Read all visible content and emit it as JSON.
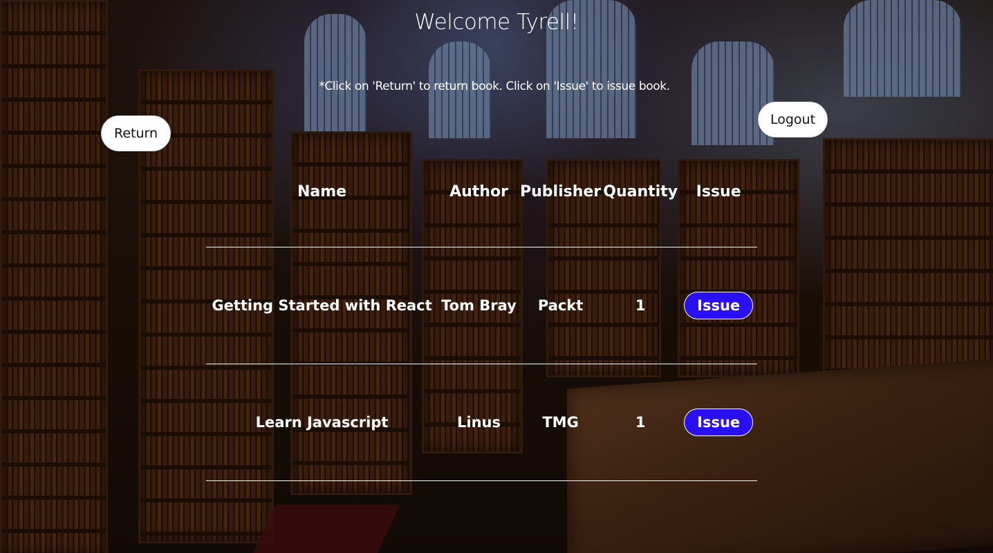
{
  "header": {
    "welcome": "Welcome Tyrell!",
    "instructions": "*Click on 'Return' to return book. Click on 'Issue' to issue book."
  },
  "buttons": {
    "return_label": "Return",
    "logout_label": "Logout"
  },
  "table": {
    "columns": [
      "Name",
      "Author",
      "Publisher",
      "Quantity",
      "Issue"
    ],
    "rows": [
      {
        "name": "Getting Started with React",
        "author": "Tom Bray",
        "publisher": "Packt",
        "quantity": "1",
        "action": "Issue"
      },
      {
        "name": "Learn Javascript",
        "author": "Linus",
        "publisher": "TMG",
        "quantity": "1",
        "action": "Issue"
      }
    ]
  },
  "colors": {
    "issue_button": "#2a10f0",
    "text": "#ffffff",
    "pill_button": "#ffffff"
  }
}
